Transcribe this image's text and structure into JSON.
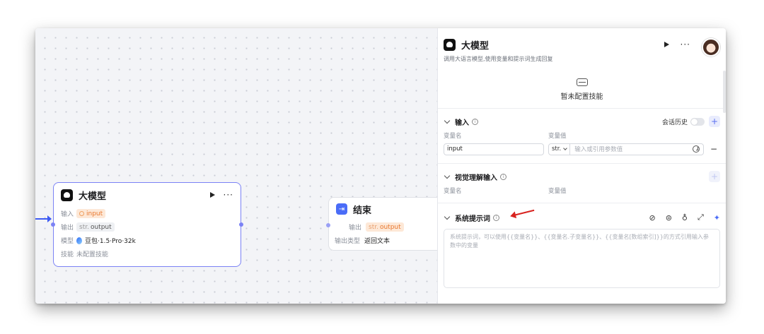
{
  "llm_node": {
    "title": "大模型",
    "input_label": "输入",
    "input_value": "input",
    "output_label": "输出",
    "output_type": "str.",
    "output_value": "output",
    "model_label": "模型",
    "model_value": "豆包·1.5·Pro·32k",
    "skill_label": "技能",
    "skill_value": "未配置技能"
  },
  "end_node": {
    "title": "结束",
    "output_label": "输出",
    "output_type": "str.",
    "output_value": "output",
    "output_type_label": "输出类型",
    "output_type_value": "返回文本"
  },
  "panel": {
    "title": "大模型",
    "description": "调用大语言模型,使用变量和提示词生成回复",
    "skill_empty": "暂未配置技能",
    "input_section": {
      "title": "输入",
      "history_label": "会话历史",
      "col_name": "变量名",
      "col_value": "变量值",
      "var_name": "input",
      "var_type": "str.",
      "var_placeholder": "输入或引用参数值"
    },
    "vision_section": {
      "title": "视觉理解输入",
      "col_name": "变量名",
      "col_value": "变量值"
    },
    "system_prompt": {
      "title": "系统提示词",
      "placeholder": "系统提示词，可以使用{{变量名}}、{{变量名.子变量名}}、{{变量名[数组索引]}}的方式引用输入参数中的变量"
    }
  },
  "icons": {
    "run": "play-icon",
    "more": "more-icon",
    "info": "info-icon"
  },
  "colors": {
    "accent": "#7b82f5",
    "link": "#4a6cf7",
    "annotation_arrow": "#d8231f"
  }
}
